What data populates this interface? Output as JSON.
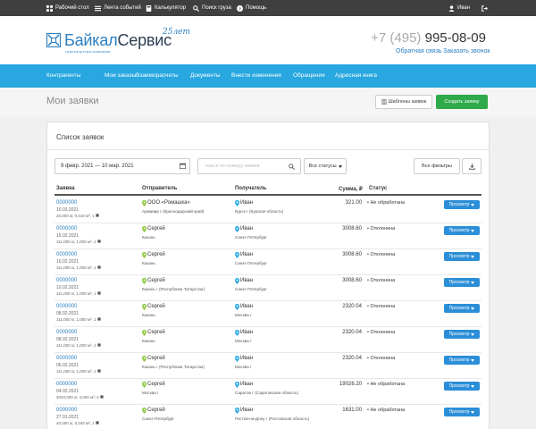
{
  "topbar": {
    "desktop": "Рабочий стол",
    "feed": "Лента событий",
    "calculator": "Калькулятор",
    "cargo_search": "Поиск груза",
    "help": "Помощь",
    "user": "Иван"
  },
  "header": {
    "logo_part1": "Байкал",
    "logo_part2": "Сервис",
    "logo_sub": "транспортная компания",
    "logo_anniv": "25лет",
    "phone_code": "+7 (495)",
    "phone_number": "995-08-09",
    "callback": "Обратная связь",
    "order_call": "Заказать звонок"
  },
  "nav": {
    "items": [
      "Контрагенты",
      "Мои заказы",
      "Взаиморасчеты",
      "Документы",
      "Внести изменения",
      "Обращения",
      "Адресная книга"
    ]
  },
  "page": {
    "title": "Мои заявки",
    "templates_button": "Шаблоны заявок",
    "create_button": "Создать заявку"
  },
  "list": {
    "title": "Список заявок",
    "date_range": "9 февр. 2021 — 10 мар. 2021",
    "search_placeholder": "поиск по номеру заявки",
    "status_filter": "Все статусы",
    "filters_button": "Все фильтры",
    "columns": {
      "order": "Заявка",
      "sender": "Отправитель",
      "receiver": "Получатель",
      "sum": "Сумма, ₽",
      "status": "Статус"
    },
    "view_label": "Просмотр",
    "rows": [
      {
        "id": "0000000",
        "date": "10.03.2021",
        "meta": "25,000 кг, 0,010 м³, 1",
        "sender": "ООО «Ромашка»",
        "sender_city": "Армавир г (Краснодарский край)",
        "receiver": "Иван",
        "receiver_city": "Курск г (Курская область)",
        "sum": "321.00",
        "status": "• Не обработана"
      },
      {
        "id": "0000000",
        "date": "15.02.2021",
        "meta": "111,000 кг, 1,000 м³, 1",
        "sender": "Сергей",
        "sender_city": "Казань",
        "receiver": "Иван",
        "receiver_city": "Санкт-Петербург",
        "sum": "3008.60",
        "status": "• Отклонена"
      },
      {
        "id": "0000000",
        "date": "10.02.2021",
        "meta": "111,000 кг, 1,000 м³, 1",
        "sender": "Сергей",
        "sender_city": "Казань",
        "receiver": "Иван",
        "receiver_city": "Санкт-Петербург",
        "sum": "3008.60",
        "status": "• Отклонена"
      },
      {
        "id": "0000000",
        "date": "10.02.2021",
        "meta": "111,000 кг, 1,000 м³, 1",
        "sender": "Сергей",
        "sender_city": "Казань г (Республика Татарстан)",
        "receiver": "Иван",
        "receiver_city": "Санкт-Петербург",
        "sum": "3008.60",
        "status": "• Отклонена"
      },
      {
        "id": "0000000",
        "date": "08.02.2021",
        "meta": "111,000 кг, 1,000 м³, 1",
        "sender": "Сергей",
        "sender_city": "Казань",
        "receiver": "Иван",
        "receiver_city": "Москва г",
        "sum": "2320.04",
        "status": "• Отклонена"
      },
      {
        "id": "0000000",
        "date": "08.02.2021",
        "meta": "111,000 кг, 1,000 м³, 1",
        "sender": "Сергей",
        "sender_city": "Казань",
        "receiver": "Иван",
        "receiver_city": "Москва г",
        "sum": "2320.04",
        "status": "• Отклонена"
      },
      {
        "id": "0000000",
        "date": "06.02.2021",
        "meta": "111,000 кг, 1,000 м³, 1",
        "sender": "Сергей",
        "sender_city": "Казань г (Республика Татарстан)",
        "receiver": "Иван",
        "receiver_city": "Москва г",
        "sum": "2320.04",
        "status": "• Отклонена"
      },
      {
        "id": "0000000",
        "date": "04.02.2021",
        "meta": "3020,000 кг, 4,000 м³, 4",
        "sender": "Сергей",
        "sender_city": "Москва г",
        "receiver": "Иван",
        "receiver_city": "Саратов г (Саратовская область)",
        "sum": "19026.20",
        "status": "• Не обработана"
      },
      {
        "id": "0000000",
        "date": "27.01.2021",
        "meta": "40,000 кг, 0,040 м³, 1",
        "sender": "Сергей",
        "sender_city": "Санкт-Петербург",
        "receiver": "Иван",
        "receiver_city": "Ростов-на-Дону г (Ростовская область)",
        "sum": "1631.00",
        "status": "• Не обработана"
      }
    ]
  },
  "colors": {
    "nav_bg": "#28a7e0",
    "topbar_bg": "#3f3f3f",
    "create_btn": "#2faa4a",
    "view_btn": "#2b8ed8",
    "link": "#2b7fc1",
    "sender_pin": "#8cc63f",
    "receiver_pin": "#28a7e0"
  }
}
